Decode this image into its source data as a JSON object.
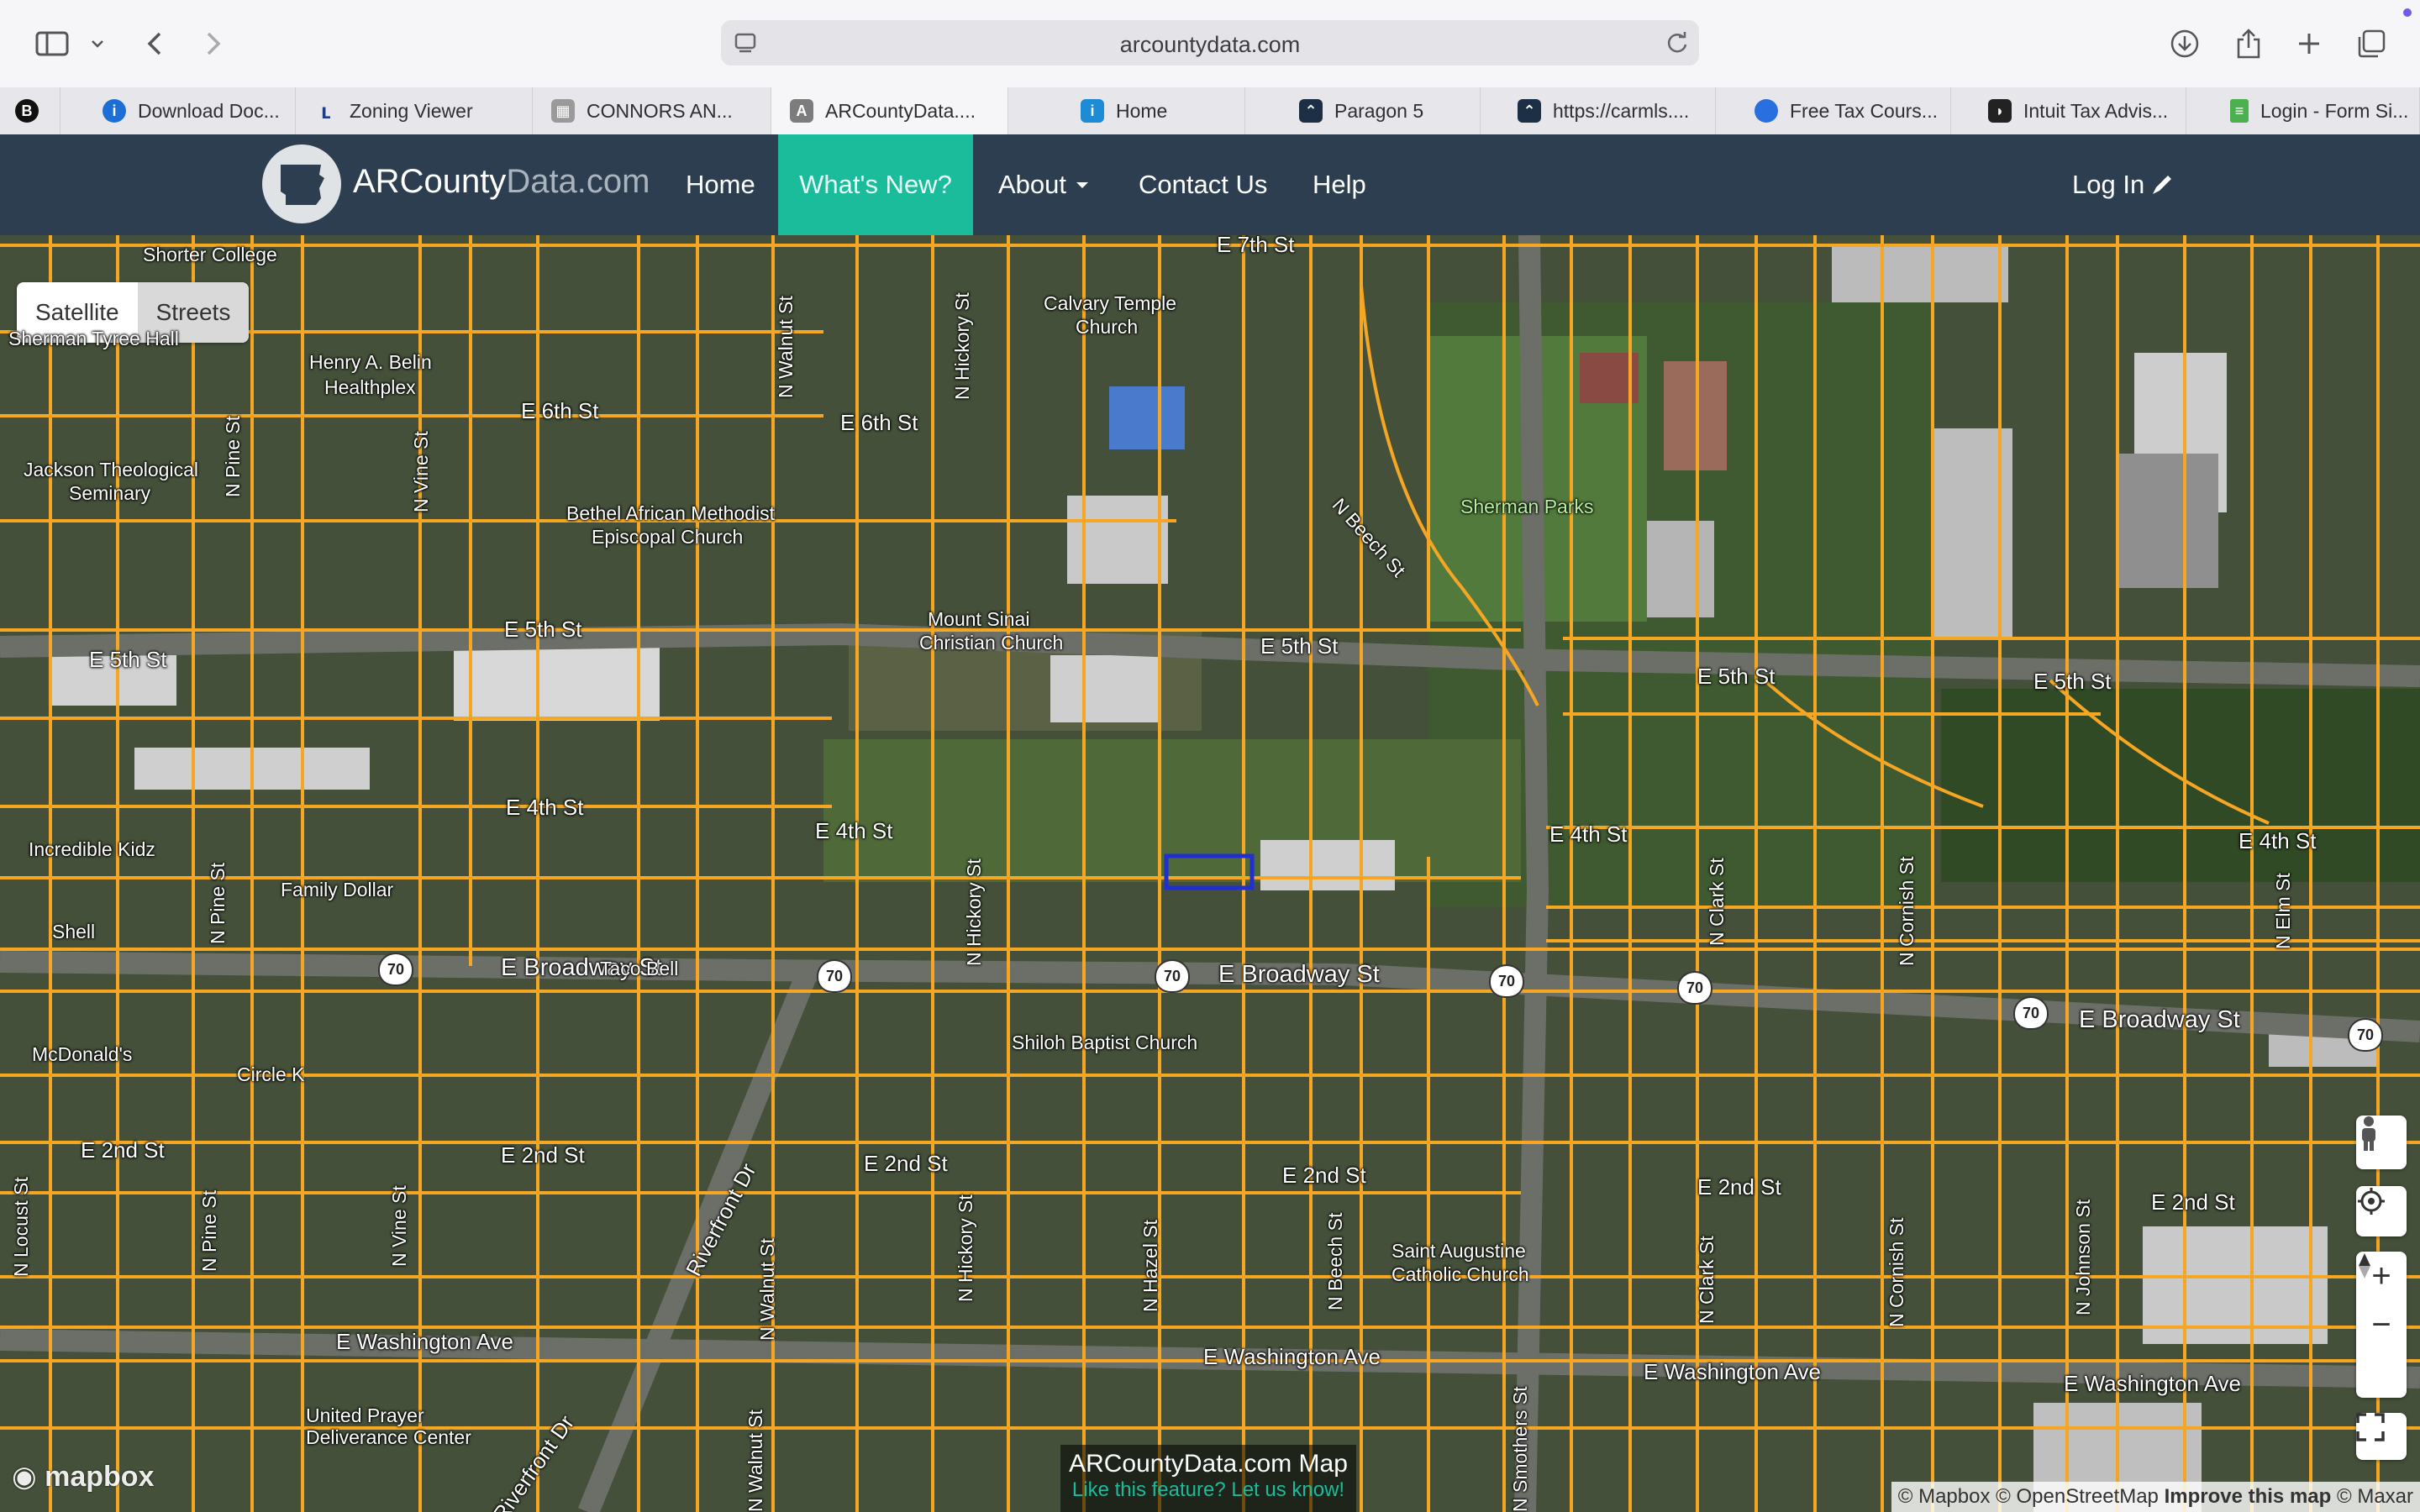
{
  "browser": {
    "url": "arcountydata.com",
    "tabs": [
      {
        "label": "B",
        "color": "#111111"
      },
      {
        "label": "Download Doc...",
        "color": "#1d6fd6"
      },
      {
        "label": "Zoning Viewer",
        "color": "#1f3c88"
      },
      {
        "label": "CONNORS AN...",
        "color": "#6b6b6b"
      },
      {
        "label": "ARCountyData....",
        "color": "#7c7c7c",
        "active": true
      },
      {
        "label": "Home",
        "color": "#1d8bd6"
      },
      {
        "label": "Paragon 5",
        "color": "#1c2f44"
      },
      {
        "label": "https://carmls....",
        "color": "#1c2f44"
      },
      {
        "label": "Free Tax Cours...",
        "color": "#2a6fe0"
      },
      {
        "label": "Intuit Tax Advis...",
        "color": "#222222"
      },
      {
        "label": "Login - Form Si...",
        "color": "#4caf50"
      }
    ]
  },
  "site": {
    "brand_main": "ARCounty",
    "brand_dim": "Data.com",
    "nav": {
      "home": "Home",
      "whats_new": "What's New?",
      "about": "About",
      "contact": "Contact Us",
      "help": "Help",
      "login": "Log In"
    }
  },
  "map": {
    "toggle": {
      "satellite": "Satellite",
      "streets": "Streets"
    },
    "caption_title": "ARCountyData.com Map",
    "caption_sub": "Like this feature? Let us know!",
    "attribution": {
      "mapbox": "© Mapbox",
      "osm": "© OpenStreetMap",
      "improve": "Improve this map",
      "maxar": "© Maxar"
    },
    "logo": "mapbox",
    "route_shield": "70",
    "streets": {
      "e7th": "E 7th St",
      "e6th_a": "E 6th St",
      "e6th_b": "E 6th St",
      "e5th_a": "E 5th St",
      "e5th_b": "E 5th St",
      "e5th_c": "E 5th St",
      "e5th_d": "E 5th St",
      "e5th_e": "E 5th St",
      "e4th_a": "E 4th St",
      "e4th_b": "E 4th St",
      "e4th_c": "E 4th St",
      "e4th_d": "E 4th St",
      "broadway_a": "E Broadway St",
      "broadway_b": "E Broadway St",
      "broadway_c": "E Broadway St",
      "e2nd_a": "E 2nd St",
      "e2nd_b": "E 2nd St",
      "e2nd_c": "E 2nd St",
      "e2nd_d": "E 2nd St",
      "e2nd_e": "E 2nd St",
      "e2nd_f": "E 2nd St",
      "washington_a": "E Washington Ave",
      "washington_b": "E Washington Ave",
      "washington_c": "E Washington Ave",
      "washington_d": "E Washington Ave",
      "riverfront_a": "Riverfront Dr",
      "riverfront_b": "Riverfront Dr",
      "beech": "N Beech St",
      "pine_a": "N Pine St",
      "pine_b": "N Pine St",
      "pine_c": "N Pine St",
      "vine_a": "N Vine St",
      "vine_b": "N Vine St",
      "walnut_a": "N Walnut St",
      "walnut_b": "N Walnut St",
      "walnut_c": "N Walnut St",
      "hickory_a": "N Hickory St",
      "hickory_b": "N Hickory St",
      "hickory_c": "N Hickory St",
      "hazel": "N Hazel St",
      "beech_b": "N Beech St",
      "clark_a": "N Clark St",
      "clark_b": "N Clark St",
      "cornish_a": "N Cornish St",
      "cornish_b": "N Cornish St",
      "johnson": "N Johnson St",
      "elm": "N Elm St",
      "locust": "N Locust St",
      "smothers": "N Smothers St"
    },
    "pois": {
      "shorter": "Shorter College",
      "sherman_hall": "Sherman Tyree Hall",
      "belin_1": "Henry A. Belin",
      "belin_2": "Healthplex",
      "jackson_1": "Jackson Theological",
      "jackson_2": "Seminary",
      "calvary_1": "Calvary Temple",
      "calvary_2": "Church",
      "bethel_1": "Bethel African Methodist",
      "bethel_2": "Episcopal Church",
      "sherman_parks": "Sherman Parks",
      "sinai_1": "Mount Sinai",
      "sinai_2": "Christian Church",
      "incredible": "Incredible Kidz",
      "family_dollar": "Family Dollar",
      "shell": "Shell",
      "taco_bell": "Taco Bell",
      "mcdonalds": "McDonald's",
      "circle_k": "Circle K",
      "shiloh": "Shiloh Baptist Church",
      "staug_1": "Saint Augustine",
      "staug_2": "Catholic Church",
      "united_1": "United Prayer",
      "united_2": "Deliverance Center"
    }
  }
}
